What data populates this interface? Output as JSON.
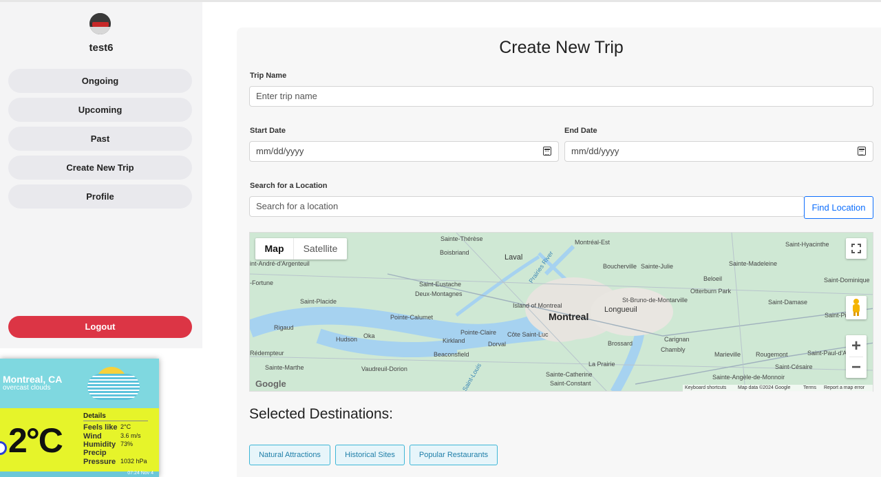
{
  "sidebar": {
    "username": "test6",
    "items": [
      {
        "label": "Ongoing"
      },
      {
        "label": "Upcoming"
      },
      {
        "label": "Past"
      },
      {
        "label": "Create New Trip"
      },
      {
        "label": "Profile"
      }
    ],
    "logout_label": "Logout"
  },
  "weather": {
    "city": "Montreal, CA",
    "description": "overcast clouds",
    "temperature": "2°C",
    "details_heading": "Details",
    "details": [
      {
        "label": "Feels like",
        "value": "2°C"
      },
      {
        "label": "Wind",
        "value": "3.6 m/s"
      },
      {
        "label": "Humidity",
        "value": "73%"
      },
      {
        "label": "Precip",
        "value": ""
      },
      {
        "label": "Pressure",
        "value": "1032 hPa"
      }
    ],
    "footer_time": "07:24 Nov 4",
    "icon": "cloud-sun-icon"
  },
  "form": {
    "title": "Create New Trip",
    "trip_name_label": "Trip Name",
    "trip_name_placeholder": "Enter trip name",
    "start_date_label": "Start Date",
    "start_date_value": "mm/dd/yyyy",
    "end_date_label": "End Date",
    "end_date_value": "mm/dd/yyyy",
    "search_label": "Search for a Location",
    "search_placeholder": "Search for a location",
    "find_button": "Find Location"
  },
  "map": {
    "type_map": "Map",
    "type_satellite": "Satellite",
    "google": "Google",
    "footer": [
      "Keyboard shortcuts",
      "Map data ©2024 Google",
      "Terms",
      "Report a map error"
    ],
    "zoom_in": "+",
    "zoom_out": "−",
    "labels": {
      "montreal": "Montreal",
      "longueuil": "Longueuil",
      "laval": "Laval",
      "brossard": "Brossard",
      "boucherville": "Boucherville",
      "saint_julie": "Sainte-Julie",
      "saint_eustache": "Saint-Eustache",
      "deux_montagnes": "Deux-Montagnes",
      "kirkland": "Kirkland",
      "beaconsfield": "Beaconsfield",
      "pointe_claire": "Pointe-Claire",
      "dorval": "Dorval",
      "hudson": "Hudson",
      "oka": "Oka",
      "rigaud": "Rigaud",
      "la_prairie": "La Prairie",
      "chambly": "Chambly",
      "beloeil": "Beloeil",
      "boisbriand": "Boisbriand",
      "sainte_therese": "Sainte-Thérèse",
      "saint_hyacinthe": "Saint-Hyacinthe",
      "saint_bruno": "St-Bruno-de-Montarville",
      "marieville": "Marieville",
      "rougemont": "Rougemont",
      "vaudreuil": "Vaudreuil-Dorion",
      "saint_catherine": "Sainte-Catherine",
      "saint_constant": "Saint-Constant",
      "saint_placide": "Saint-Placide",
      "pointe_calumet": "Pointe-Calumet",
      "cote_saint_luc": "Côte Saint-Luc",
      "carignan": "Carignan",
      "otterburn": "Otterburn Park",
      "saint_damase": "Saint-Damase",
      "saint_pie": "Saint-Pie",
      "saint_cesaire": "Saint-Césaire",
      "saint_angele": "Sainte-Angèle-de-Monnoir",
      "saint_madeleine": "Sainte-Madeleine",
      "saint_dominique": "Saint-Dominique",
      "saint_marthe": "Sainte-Marthe",
      "redempteur": "Rédempteur",
      "fortune": "-Fortune",
      "saint_andre": "int-André-d'Argenteuil",
      "montreal_est": "Montréal-Est",
      "island_of_montreal": "Island of Montreal",
      "riviere_des_prairies": "Prairies River",
      "saint_paul": "Saint-Paul-d'A",
      "saint_louis": "Saint-Louis"
    }
  },
  "selected": {
    "heading": "Selected Destinations:",
    "categories": [
      "Natural Attractions",
      "Historical Sites",
      "Popular Restaurants"
    ]
  }
}
